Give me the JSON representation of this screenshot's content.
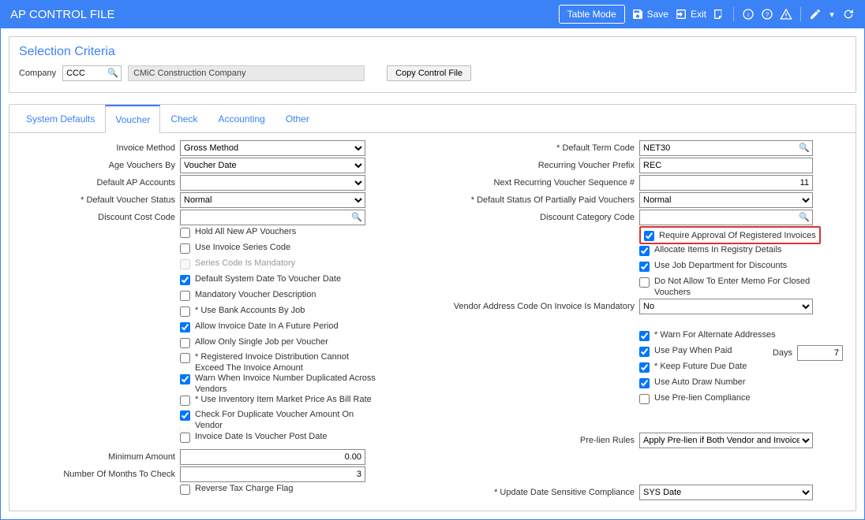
{
  "title": "AP CONTROL FILE",
  "toolbar": {
    "table_mode": "Table Mode",
    "save": "Save",
    "exit": "Exit"
  },
  "criteria": {
    "heading": "Selection Criteria",
    "company_label": "Company",
    "company_code": "CCC",
    "company_name": "CMiC Construction Company",
    "copy_btn": "Copy Control File"
  },
  "tabs": [
    "System Defaults",
    "Voucher",
    "Check",
    "Accounting",
    "Other"
  ],
  "active_tab": "Voucher",
  "left": {
    "invoice_method_label": "Invoice Method",
    "invoice_method_value": "Gross Method",
    "age_vouchers_label": "Age Vouchers By",
    "age_vouchers_value": "Voucher Date",
    "default_ap_accounts_label": "Default AP Accounts",
    "default_ap_accounts_value": "",
    "default_voucher_status_label": "Default Voucher Status",
    "default_voucher_status_value": "Normal",
    "discount_cost_code_label": "Discount Cost Code",
    "discount_cost_code_value": "",
    "minimum_amount_label": "Minimum Amount",
    "minimum_amount_value": "0.00",
    "months_to_check_label": "Number Of Months To Check",
    "months_to_check_value": "3",
    "checks": {
      "hold_all": "Hold All New AP Vouchers",
      "use_invoice_series": "Use Invoice Series Code",
      "series_mandatory": "Series Code Is Mandatory",
      "default_sys_date": "Default System Date To Voucher Date",
      "mandatory_desc": "Mandatory Voucher Description",
      "use_bank_by_job": "Use Bank Accounts By Job",
      "allow_future": "Allow Invoice Date In A Future Period",
      "allow_single_job": "Allow Only Single Job per Voucher",
      "reg_inv_dist": "Registered Invoice Distribution Cannot Exceed The Invoice Amount",
      "warn_dup": "Warn When Invoice Number Duplicated Across Vendors",
      "inv_item_price": "Use Inventory Item Market Price As Bill Rate",
      "check_dup_vchr": "Check For Duplicate Voucher Amount On Vendor",
      "inv_date_is_post": "Invoice Date Is Voucher Post Date",
      "reverse_tax": "Reverse Tax Charge Flag"
    }
  },
  "right": {
    "default_term_label": "Default Term Code",
    "default_term_value": "NET30",
    "recurring_prefix_label": "Recurring Voucher Prefix",
    "recurring_prefix_value": "REC",
    "next_recur_seq_label": "Next Recurring Voucher Sequence #",
    "next_recur_seq_value": "11",
    "default_status_ppv_label": "Default Status Of Partially Paid Vouchers",
    "default_status_ppv_value": "Normal",
    "discount_cat_label": "Discount Category Code",
    "discount_cat_value": "",
    "vendor_addr_mand_label": "Vendor Address Code On Invoice Is Mandatory",
    "vendor_addr_mand_value": "No",
    "days_label": "Days",
    "days_value": "7",
    "prelien_rules_label": "Pre-lien Rules",
    "prelien_rules_value": "Apply Pre-lien if Both Vendor and Invoice Se",
    "update_date_sens_label": "Update Date Sensitive Compliance",
    "update_date_sens_value": "SYS Date",
    "checks": {
      "require_approval": "Require Approval Of Registered Invoices",
      "allocate_items": "Allocate Items In Registry Details",
      "use_job_dept": "Use Job Department for Discounts",
      "no_memo_closed": "Do Not Allow To Enter Memo For Closed Vouchers",
      "warn_alt_addr": "Warn For Alternate Addresses",
      "use_pay_when_paid": "Use Pay When Paid",
      "keep_future_due": "Keep Future Due Date",
      "use_auto_draw": "Use Auto Draw Number",
      "use_prelien_comp": "Use Pre-lien Compliance"
    }
  }
}
